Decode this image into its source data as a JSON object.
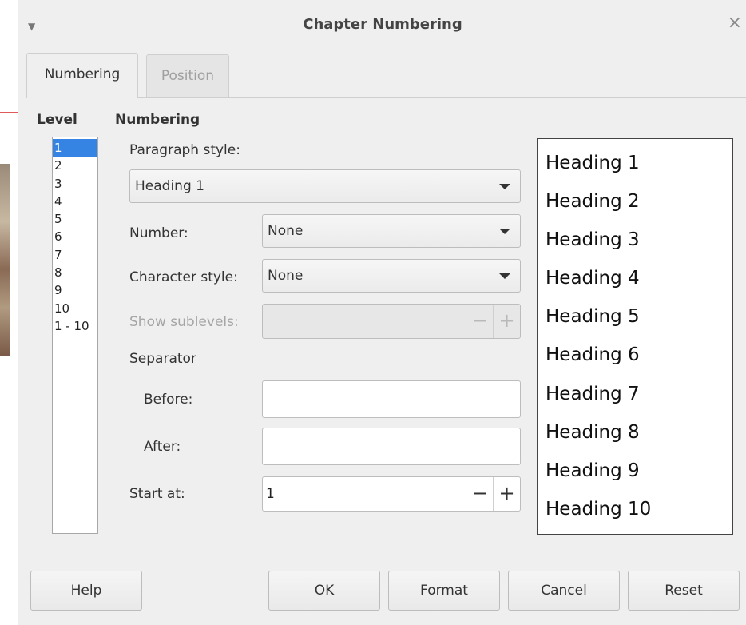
{
  "dialog": {
    "title": "Chapter Numbering",
    "close_glyph": "×",
    "menu_glyph": "▼"
  },
  "tabs": [
    {
      "label": "Numbering",
      "active": true
    },
    {
      "label": "Position",
      "active": false
    }
  ],
  "level": {
    "heading": "Level",
    "items": [
      "1",
      "2",
      "3",
      "4",
      "5",
      "6",
      "7",
      "8",
      "9",
      "10",
      "1 - 10"
    ],
    "selected": "1"
  },
  "numbering": {
    "heading": "Numbering",
    "paragraph_style_label": "Paragraph style:",
    "paragraph_style_value": "Heading 1",
    "number_label": "Number:",
    "number_value": "None",
    "character_style_label": "Character style:",
    "character_style_value": "None",
    "show_sublevels_label": "Show sublevels:",
    "show_sublevels_value": "",
    "separator_label": "Separator",
    "before_label": "Before:",
    "before_value": "",
    "after_label": "After:",
    "after_value": "",
    "start_at_label": "Start at:",
    "start_at_value": "1",
    "minus_glyph": "−",
    "plus_glyph": "+"
  },
  "preview": {
    "items": [
      "Heading 1",
      "Heading 2",
      "Heading 3",
      "Heading 4",
      "Heading 5",
      "Heading 6",
      "Heading 7",
      "Heading 8",
      "Heading 9",
      "Heading 10"
    ]
  },
  "buttons": {
    "help": "Help",
    "ok": "OK",
    "format": "Format",
    "cancel": "Cancel",
    "reset": "Reset"
  },
  "colors": {
    "selection": "#3584e4",
    "dialog_bg": "#efefef"
  }
}
